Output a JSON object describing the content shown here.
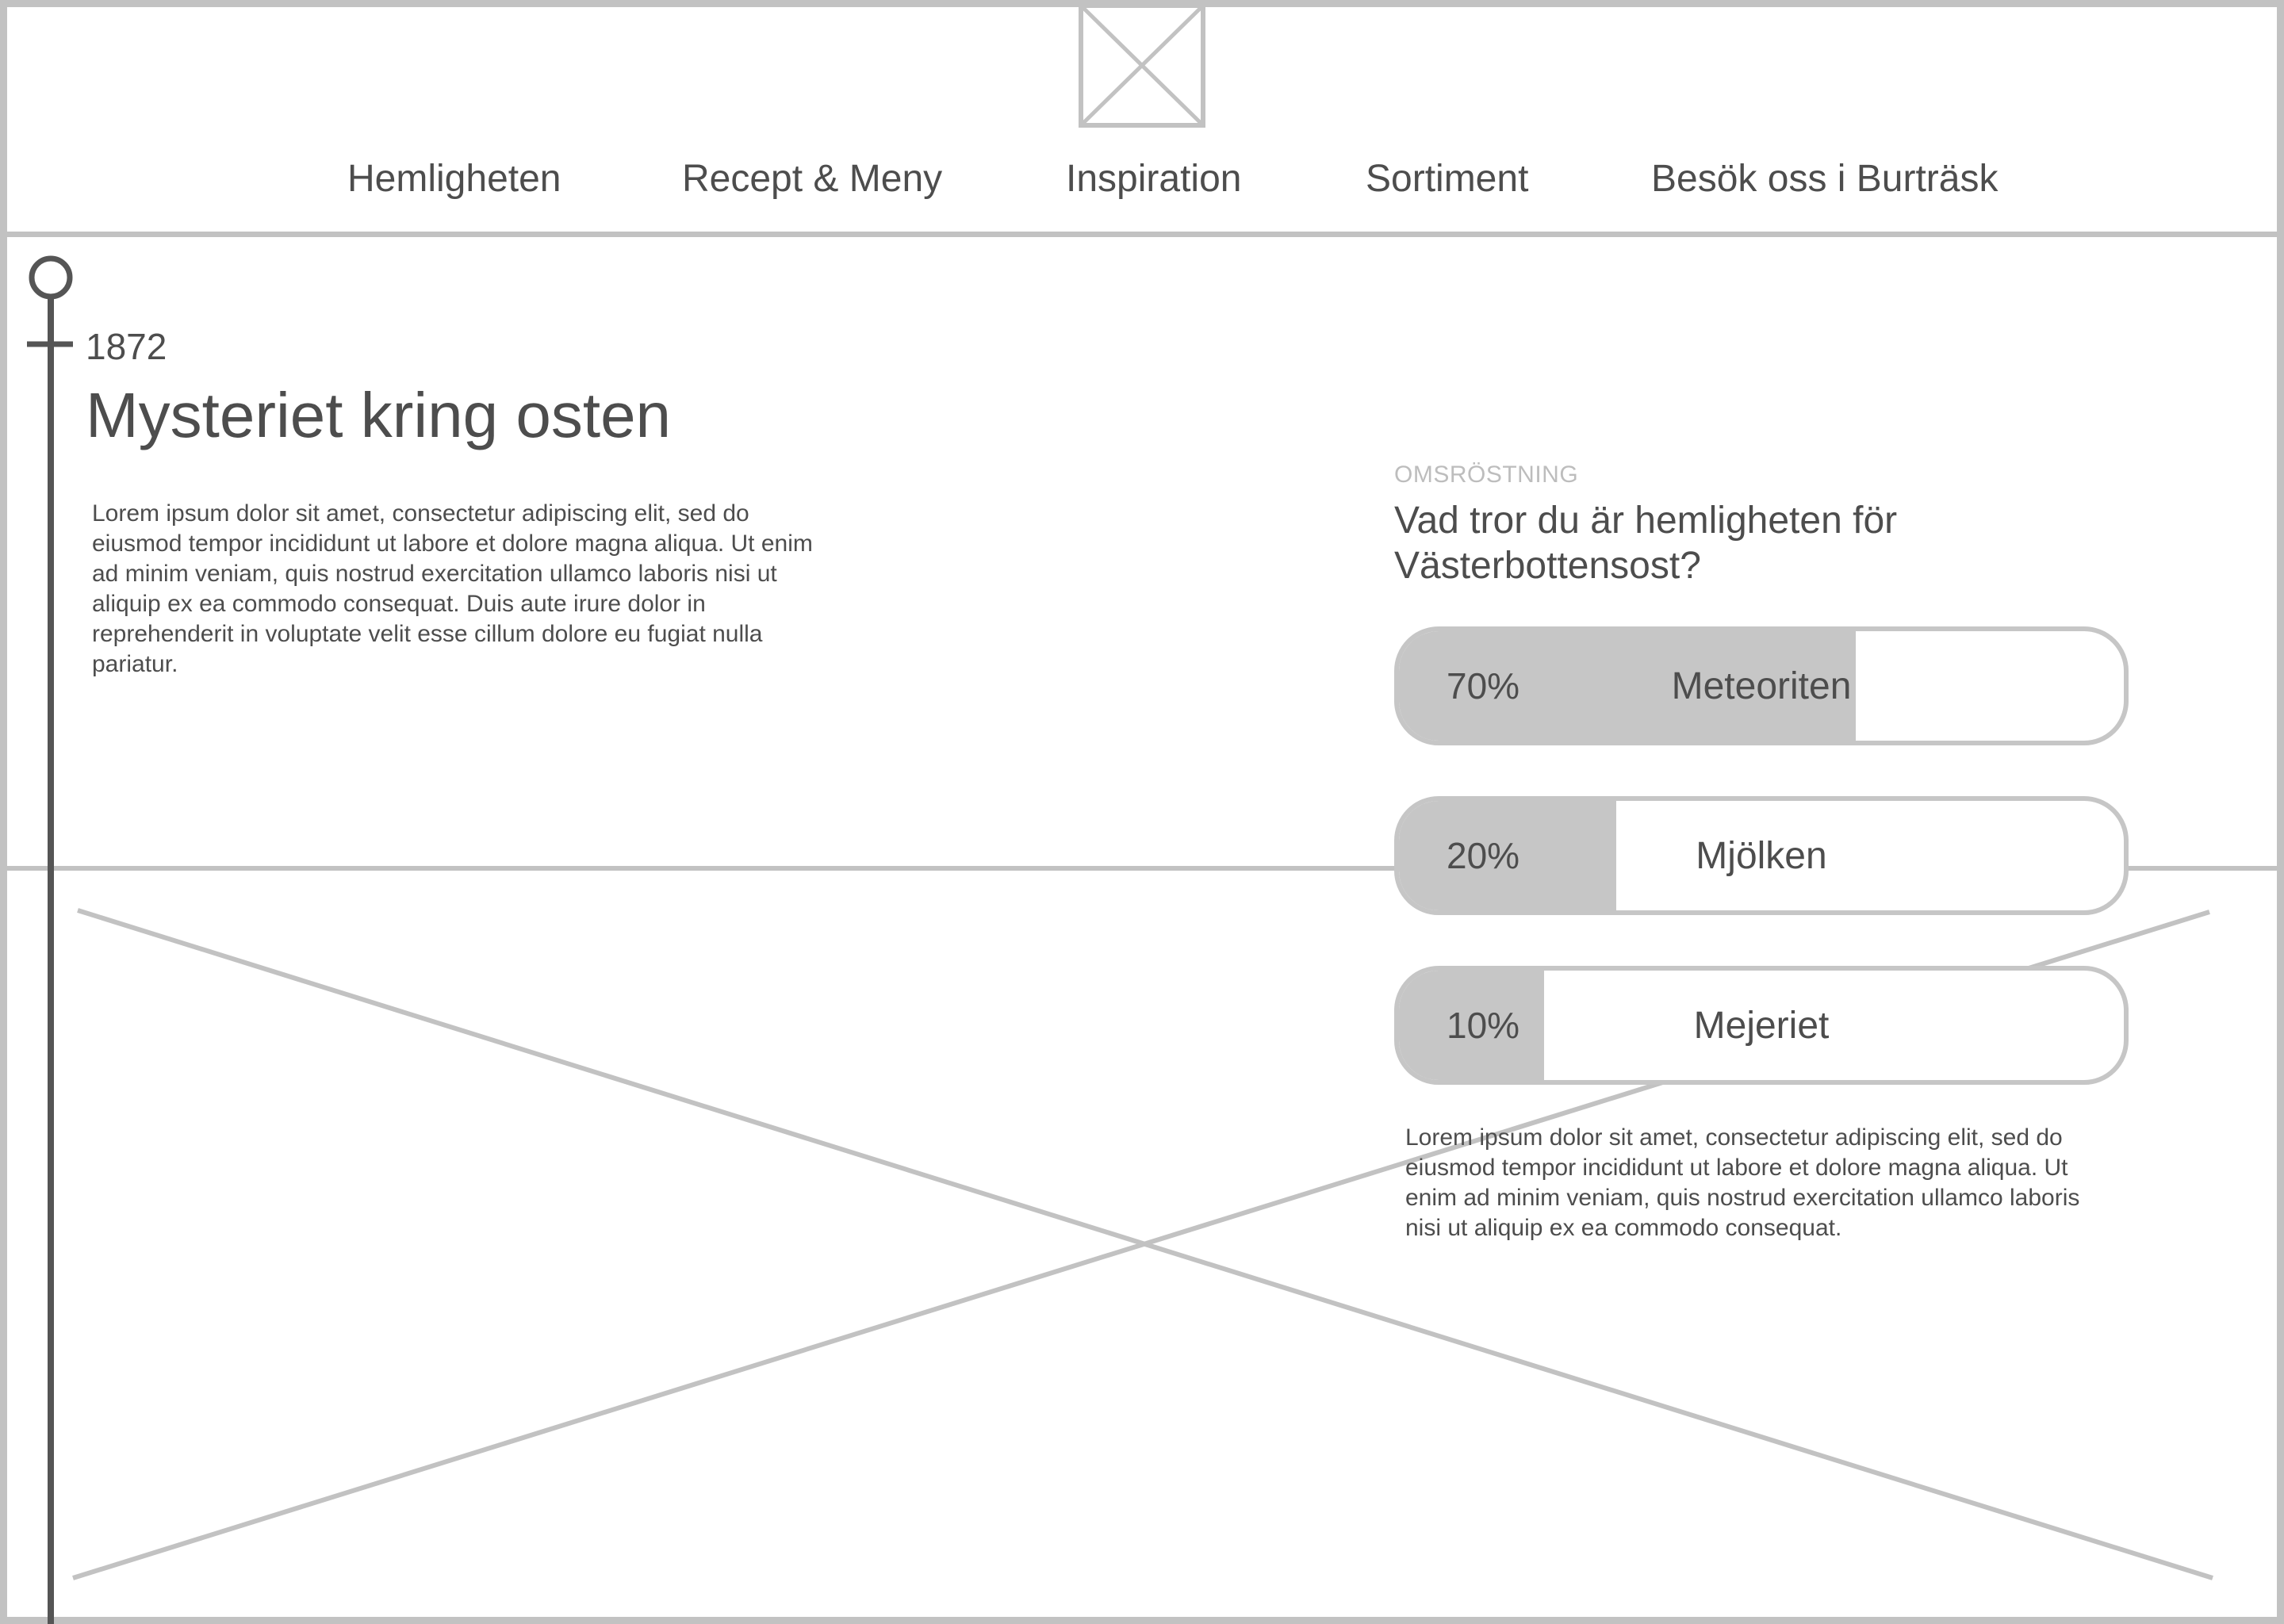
{
  "nav": {
    "items": [
      {
        "label": "Hemligheten"
      },
      {
        "label": "Recept & Meny"
      },
      {
        "label": "Inspiration"
      },
      {
        "label": "Sortiment"
      },
      {
        "label": "Besök oss i Burträsk"
      }
    ]
  },
  "article": {
    "year": "1872",
    "title": "Mysteriet kring osten",
    "intro": "Lorem ipsum dolor sit amet, consectetur adipiscing elit, sed do eiusmod tempor incididunt ut labore et dolore magna aliqua. Ut enim ad minim veniam, quis nostrud exercitation ullamco laboris nisi ut aliquip ex ea commodo consequat. Duis aute irure dolor in reprehenderit in voluptate velit esse cillum dolore eu fugiat nulla pariatur."
  },
  "poll": {
    "eyebrow": "OMSRÖSTNING",
    "question": "Vad tror du är hemligheten för Västerbottensost?",
    "options": [
      {
        "percent_label": "70%",
        "label": "Meteoriten",
        "share": 0.63
      },
      {
        "percent_label": "20%",
        "label": "Mjölken",
        "share": 0.3
      },
      {
        "percent_label": "10%",
        "label": "Mejeriet",
        "share": 0.2
      }
    ],
    "body": "Lorem ipsum dolor sit amet, consectetur adipiscing elit, sed do eiusmod tempor incididunt ut labore et dolore magna aliqua. Ut enim ad minim veniam, quis nostrud exercitation ullamco laboris nisi ut aliquip ex ea commodo consequat."
  },
  "colors": {
    "text": "#4d4d4d",
    "wireframe": "#c2c2c2",
    "timeline": "#555555",
    "muted": "#bdbdbd"
  },
  "icons": {
    "logo": "image-placeholder-icon",
    "hero": "image-placeholder-icon",
    "timeline_start": "circle-node-icon"
  }
}
